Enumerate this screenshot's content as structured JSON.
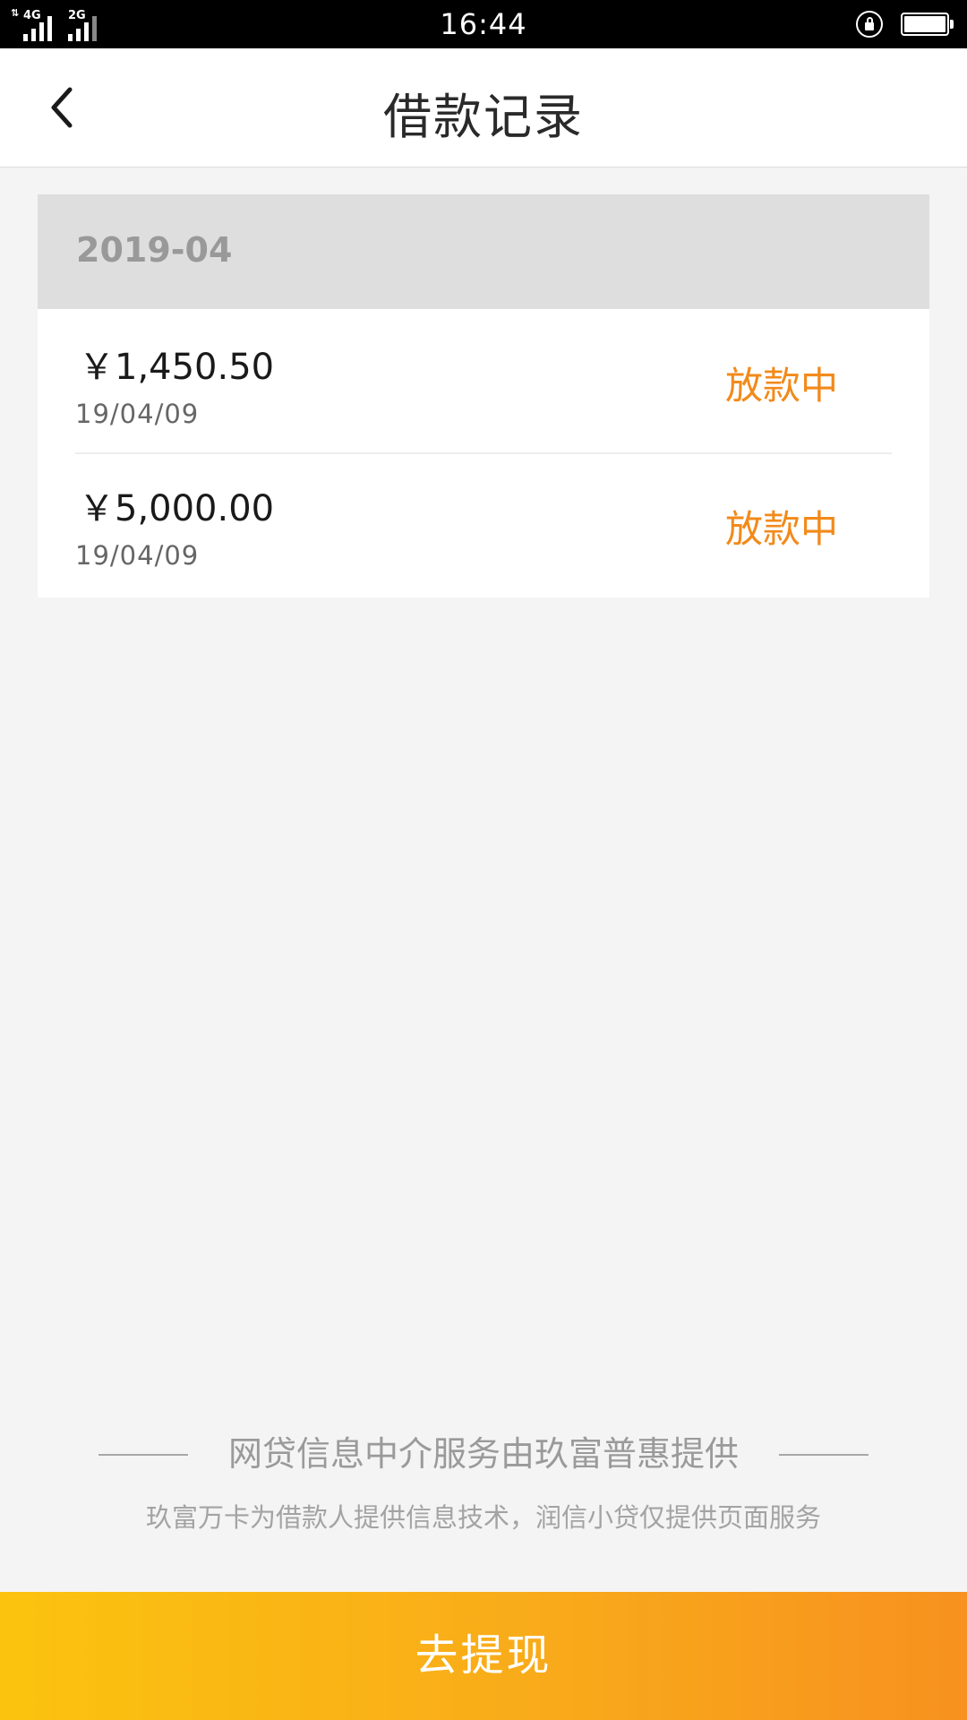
{
  "status_bar": {
    "time": "16:44",
    "network_primary": "4G",
    "network_secondary": "2G",
    "icons": [
      "signal-icon",
      "rotation-lock-icon",
      "battery-icon"
    ]
  },
  "header": {
    "title": "借款记录",
    "back_icon": "chevron-left-icon"
  },
  "records": {
    "month": "2019-04",
    "items": [
      {
        "amount": "￥1,450.50",
        "date": "19/04/09",
        "status": "放款中"
      },
      {
        "amount": "￥5,000.00",
        "date": "19/04/09",
        "status": "放款中"
      }
    ]
  },
  "footer": {
    "provider": "网贷信息中介服务由玖富普惠提供",
    "note": "玖富万卡为借款人提供信息技术，润信小贷仅提供页面服务"
  },
  "action": {
    "withdraw_label": "去提现"
  },
  "colors": {
    "status_orange": "#f28a1a",
    "button_gradient_start": "#fbc30e",
    "button_gradient_end": "#f7911f",
    "month_header_bg": "#dedede",
    "page_bg": "#f4f4f4"
  }
}
